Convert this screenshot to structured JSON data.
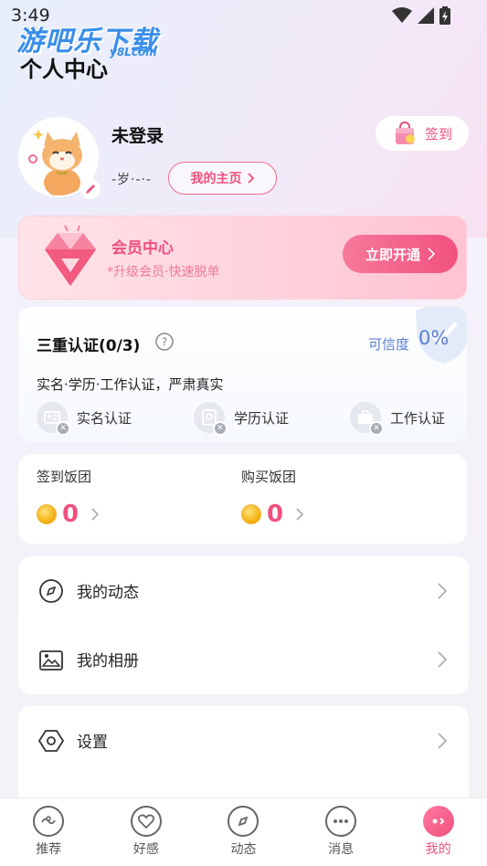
{
  "status_bar": {
    "time": "3:49"
  },
  "watermark": {
    "main": "游吧乐下载",
    "sub": "y8Lcom"
  },
  "page_title": "个人中心",
  "profile": {
    "username": "未登录",
    "meta": "-岁·-·-",
    "homepage_label": "我的主页",
    "checkin_label": "签到"
  },
  "vip": {
    "title": "会员中心",
    "subtitle": "*升级会员·快速脱单",
    "button_label": "立即开通"
  },
  "certification": {
    "title": "三重认证(0/3)",
    "credibility_label": "可信度",
    "credibility_value": "0%",
    "description": "实名·学历·工作认证，严肃真实",
    "items": [
      {
        "label": "实名认证",
        "icon": "id-card-icon"
      },
      {
        "label": "学历认证",
        "icon": "education-icon"
      },
      {
        "label": "工作认证",
        "icon": "briefcase-icon"
      }
    ]
  },
  "coins": {
    "checkin": {
      "label": "签到饭团",
      "value": "0"
    },
    "purchase": {
      "label": "购买饭团",
      "value": "0"
    }
  },
  "menu": {
    "group1": [
      {
        "label": "我的动态",
        "icon": "compass-icon"
      },
      {
        "label": "我的相册",
        "icon": "photo-album-icon"
      }
    ],
    "group2": [
      {
        "label": "设置",
        "icon": "settings-icon"
      }
    ]
  },
  "tabbar": {
    "items": [
      {
        "label": "推荐",
        "icon": "recommend-icon"
      },
      {
        "label": "好感",
        "icon": "heart-icon"
      },
      {
        "label": "动态",
        "icon": "compass-icon"
      },
      {
        "label": "消息",
        "icon": "message-icon"
      },
      {
        "label": "我的",
        "icon": "profile-icon",
        "active": true
      }
    ]
  },
  "colors": {
    "accent": "#f0507e",
    "credibility": "#5b7fd6",
    "vip_bg": "#ffd1dc"
  }
}
